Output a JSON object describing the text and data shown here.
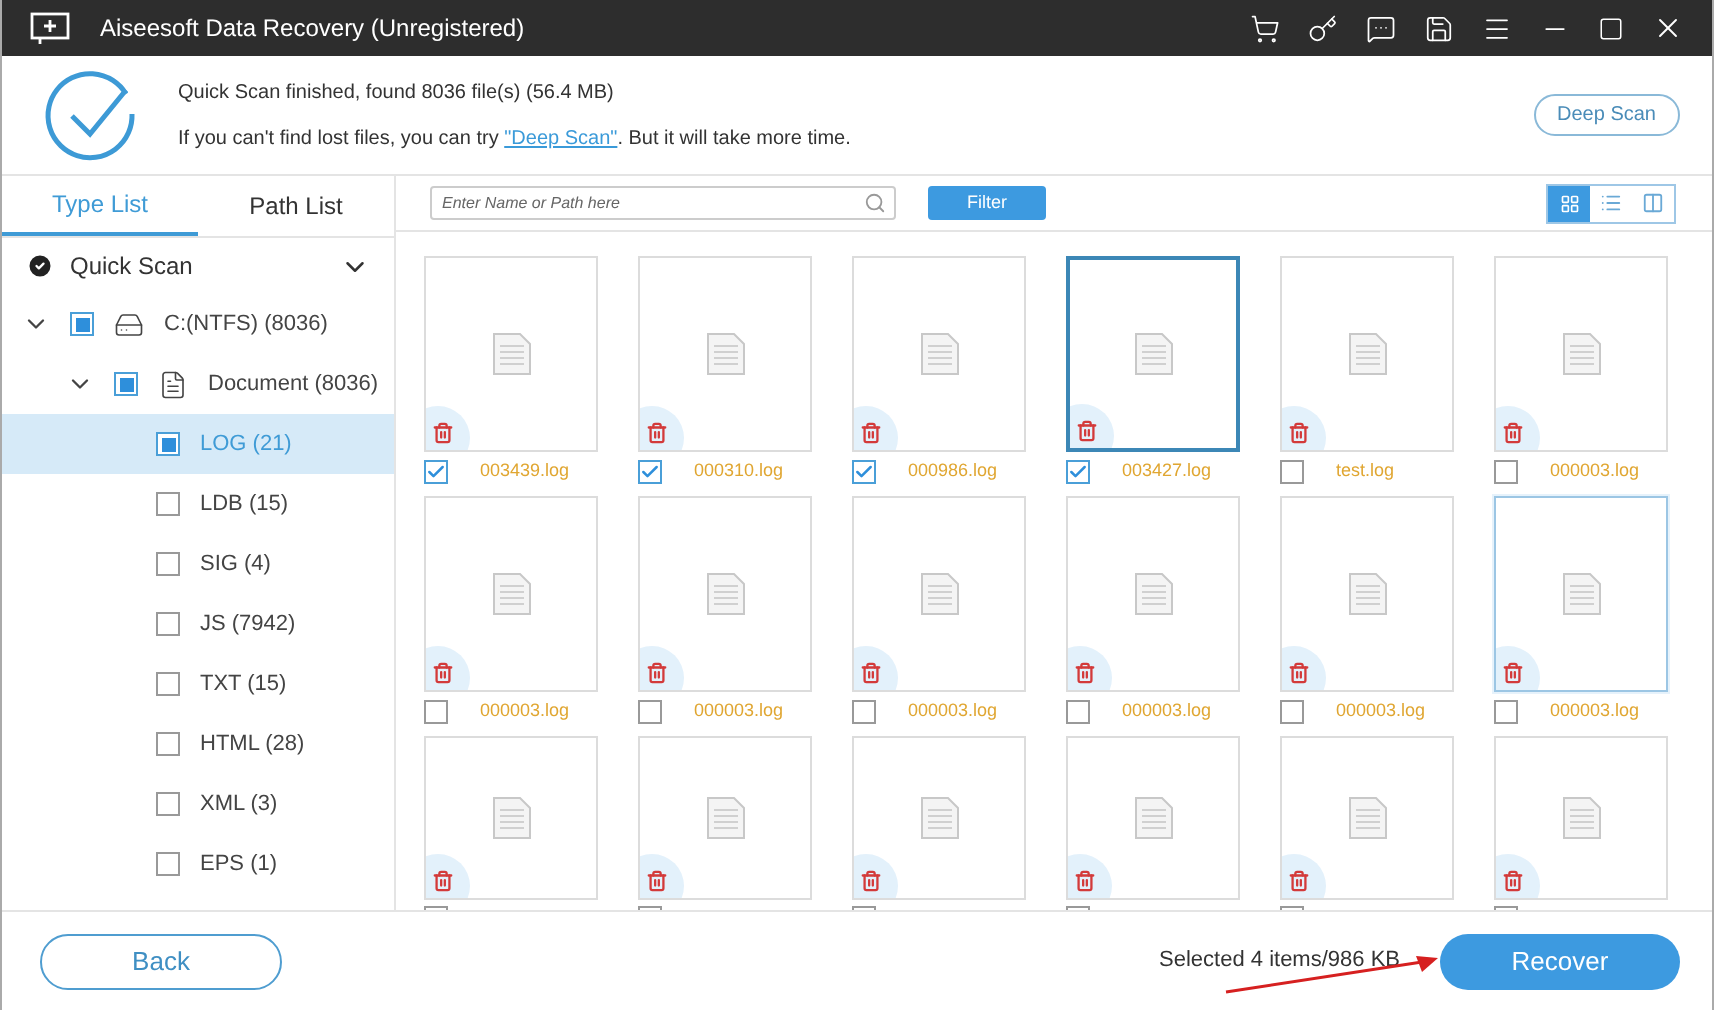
{
  "window": {
    "title": "Aiseesoft Data Recovery (Unregistered)"
  },
  "header": {
    "status": "Quick Scan finished, found 8036 file(s) (56.4 MB)",
    "hint_before": "If you can't find lost files, you can try ",
    "hint_link": "\"Deep Scan\"",
    "hint_after": ". But it will take more time.",
    "deep_scan_button": "Deep Scan"
  },
  "sidebar": {
    "tabs": [
      {
        "label": "Type List",
        "selected": true
      },
      {
        "label": "Path List",
        "selected": false
      }
    ],
    "scan_mode": "Quick Scan",
    "tree": [
      {
        "label": "C:(NTFS) (8036)",
        "kind": "drive",
        "checked": true,
        "expanded": true,
        "selected": false,
        "children": [
          {
            "label": "Document (8036)",
            "kind": "folder",
            "checked": true,
            "expanded": true,
            "selected": false,
            "children": [
              {
                "label": "LOG (21)",
                "checked": true,
                "selected": true
              },
              {
                "label": "LDB (15)",
                "checked": false,
                "selected": false
              },
              {
                "label": "SIG (4)",
                "checked": false,
                "selected": false
              },
              {
                "label": "JS (7942)",
                "checked": false,
                "selected": false
              },
              {
                "label": "TXT (15)",
                "checked": false,
                "selected": false
              },
              {
                "label": "HTML (28)",
                "checked": false,
                "selected": false
              },
              {
                "label": "XML (3)",
                "checked": false,
                "selected": false
              },
              {
                "label": "EPS (1)",
                "checked": false,
                "selected": false
              }
            ]
          }
        ]
      }
    ]
  },
  "toolbar": {
    "search": {
      "placeholder": "Enter Name or Path here"
    },
    "filter_button": "Filter",
    "views": [
      {
        "kind": "grid",
        "selected": true
      },
      {
        "kind": "list",
        "selected": false
      },
      {
        "kind": "columns",
        "selected": false
      }
    ]
  },
  "files": [
    {
      "name": "003439.log",
      "checked": true,
      "selected": false,
      "hovered": false
    },
    {
      "name": "000310.log",
      "checked": true,
      "selected": false,
      "hovered": false
    },
    {
      "name": "000986.log",
      "checked": true,
      "selected": false,
      "hovered": false
    },
    {
      "name": "003427.log",
      "checked": true,
      "selected": true,
      "hovered": false
    },
    {
      "name": "test.log",
      "checked": false,
      "selected": false,
      "hovered": false
    },
    {
      "name": "000003.log",
      "checked": false,
      "selected": false,
      "hovered": false
    },
    {
      "name": "000003.log",
      "checked": false,
      "selected": false,
      "hovered": false
    },
    {
      "name": "000003.log",
      "checked": false,
      "selected": false,
      "hovered": false
    },
    {
      "name": "000003.log",
      "checked": false,
      "selected": false,
      "hovered": false
    },
    {
      "name": "000003.log",
      "checked": false,
      "selected": false,
      "hovered": false
    },
    {
      "name": "000003.log",
      "checked": false,
      "selected": false,
      "hovered": false
    },
    {
      "name": "000003.log",
      "checked": false,
      "selected": false,
      "hovered": true
    }
  ],
  "partial_files": [
    {
      "checked": false
    },
    {
      "checked": false
    },
    {
      "checked": false
    },
    {
      "checked": false
    },
    {
      "checked": false
    },
    {
      "checked": false
    }
  ],
  "footer": {
    "back_button": "Back",
    "selection": "Selected 4 items/986 KB",
    "recover_button": "Recover"
  }
}
